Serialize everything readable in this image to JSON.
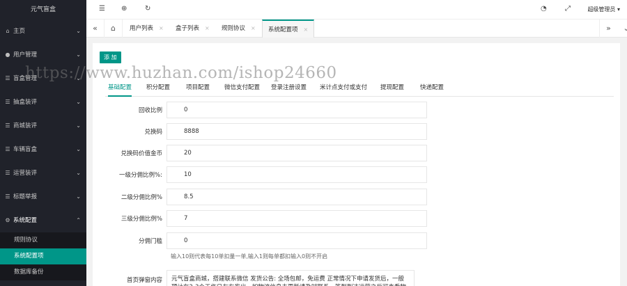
{
  "app": {
    "title": "元气盲盒"
  },
  "sidebar": {
    "items": [
      {
        "label": "主页",
        "icon": "home-icon"
      },
      {
        "label": "用户管理",
        "icon": "users-icon"
      },
      {
        "label": "盲盒管理",
        "icon": "list-icon"
      },
      {
        "label": "抽盒装评",
        "icon": "list-icon"
      },
      {
        "label": "商城装评",
        "icon": "list-icon"
      },
      {
        "label": "车辆盲盒",
        "icon": "list-icon"
      },
      {
        "label": "运营装评",
        "icon": "list-icon"
      },
      {
        "label": "标题举报",
        "icon": "list-icon"
      },
      {
        "label": "系统配置",
        "icon": "gear-icon"
      }
    ],
    "sub_items": [
      {
        "label": "规则协议"
      },
      {
        "label": "系统配置项"
      },
      {
        "label": "数据库备份"
      }
    ]
  },
  "header": {
    "user": "超级管理员"
  },
  "tabs": [
    {
      "label": "用户列表"
    },
    {
      "label": "盒子列表"
    },
    {
      "label": "规则协议"
    },
    {
      "label": "系统配置项"
    }
  ],
  "card": {
    "add_label": "添 加",
    "sub_tabs": [
      "基础配置",
      "积分配置",
      "项目配置",
      "微信支付配置",
      "登录注册设置",
      "米计点支付或支付",
      "提现配置",
      "快递配置"
    ],
    "fields": [
      {
        "label": "回收比例",
        "value": "0"
      },
      {
        "label": "兑换码",
        "value": "8888"
      },
      {
        "label": "兑换码价值金币",
        "value": "20"
      },
      {
        "label": "一级分佣比例%:",
        "value": "10"
      },
      {
        "label": "二级分佣比例%",
        "value": "8.5"
      },
      {
        "label": "三级分佣比例%",
        "value": "7"
      },
      {
        "label": "分佣门槛",
        "value": "0"
      }
    ],
    "hint": "输入10则代表每10单扣量一单,输入1则每单都扣输入0则不开启",
    "textarea_label": "首页弹窗内容",
    "textarea_value": "元气盲盒商城，搭建联系微信 发货公告: 全场包邮，免运费 正常情况下申请发货后，一般预计在2-3个工作日左右发出，如物流信息未更新请及时联系，签到到达运营之后可查看物流"
  },
  "watermark": "https://www.huzhan.com/ishop24660"
}
